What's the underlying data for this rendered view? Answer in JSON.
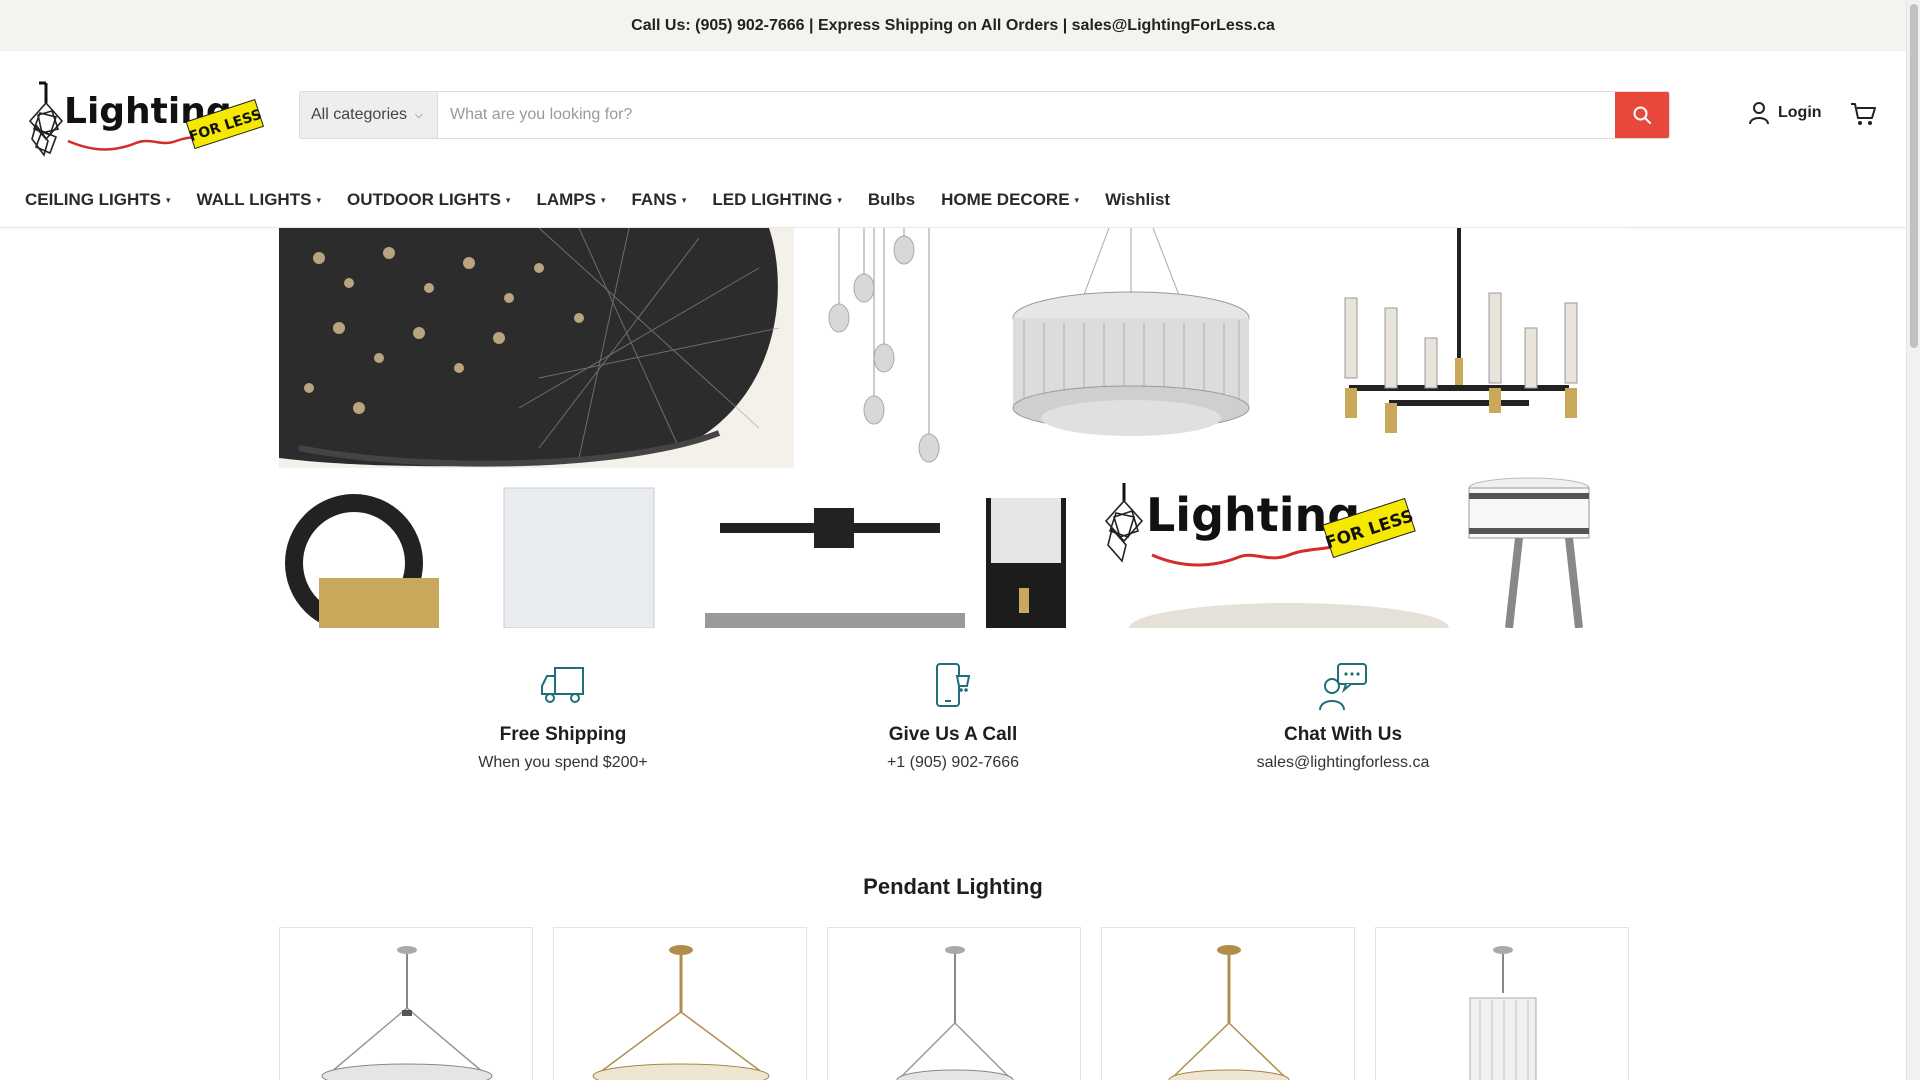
{
  "announcement": {
    "text": "Call Us: (905) 902-7666 | Express Shipping on All Orders | sales@LightingForLess.ca"
  },
  "logo": {
    "wordmark": "Lighting",
    "tag": "FOR LESS"
  },
  "search": {
    "category": "All categories",
    "placeholder": "What are you looking for?",
    "value": ""
  },
  "account": {
    "login_label": "Login"
  },
  "nav": {
    "items": [
      {
        "label": "CEILING LIGHTS",
        "dropdown": true
      },
      {
        "label": "WALL LIGHTS",
        "dropdown": true
      },
      {
        "label": "OUTDOOR LIGHTS",
        "dropdown": true
      },
      {
        "label": "LAMPS",
        "dropdown": true
      },
      {
        "label": "FANS",
        "dropdown": true
      },
      {
        "label": "LED LIGHTING",
        "dropdown": true
      },
      {
        "label": "Bulbs",
        "dropdown": false
      },
      {
        "label": "HOME DECORE",
        "dropdown": true
      },
      {
        "label": "Wishlist",
        "dropdown": false
      }
    ]
  },
  "hero": {
    "logo_wordmark": "Lighting",
    "logo_tag": "FOR LESS"
  },
  "features": [
    {
      "icon": "truck-icon",
      "title": "Free Shipping",
      "subtitle": "When you spend $200+"
    },
    {
      "icon": "phone-icon",
      "title": "Give Us A Call",
      "subtitle": "+1 (905) 902-7666"
    },
    {
      "icon": "chat-icon",
      "title": "Chat With Us",
      "subtitle": "sales@lightingforless.ca"
    }
  ],
  "section": {
    "title": "Pendant Lighting"
  },
  "colors": {
    "accent": "#e8483b",
    "icon_teal": "#1f6f7a",
    "announce_bg": "#f4f3ef",
    "logo_yellow": "#f6e900"
  }
}
